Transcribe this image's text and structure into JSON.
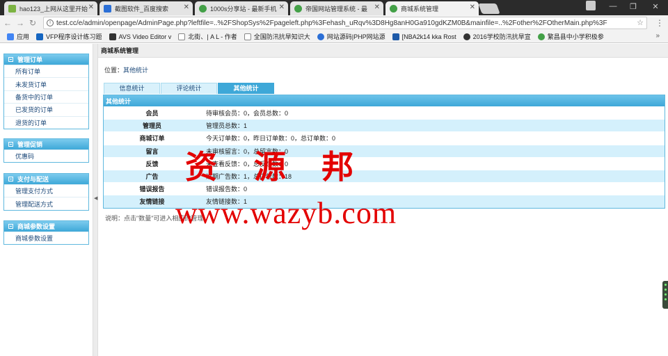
{
  "browser": {
    "tabs": [
      {
        "label": "hao123_上网从这里开始",
        "icon": "hao123-icon",
        "color": "#7cb342"
      },
      {
        "label": "截图软件_百度搜索",
        "icon": "baidu-paw-icon",
        "color": "#2b6fd6"
      },
      {
        "label": "1000s分享站 - 最新手机",
        "icon": "site-icon",
        "color": "#43a047"
      },
      {
        "label": "帝国网站管理系统 - 最",
        "icon": "site-icon",
        "color": "#43a047"
      },
      {
        "label": "商城系统管理",
        "icon": "site-icon",
        "color": "#43a047"
      }
    ],
    "url": "test.cc/e/admin/openpage/AdminPage.php?leftfile=..%2FShopSys%2Fpageleft.php%3Fehash_uRqv%3D8Hg8anH0Ga910gdKZM0B&mainfile=..%2Fother%2FOtherMain.php%3F",
    "bookmarks": [
      {
        "label": "应用",
        "color": "#4285f4"
      },
      {
        "label": "VFP程序设计练习题",
        "color": "#1565c0"
      },
      {
        "label": "AVS Video Editor v",
        "color": "#333333"
      },
      {
        "label": "北街、| A L - 作者",
        "color": "#888888"
      },
      {
        "label": "全国防汛抗旱知识大",
        "color": "#555555"
      },
      {
        "label": "网站源码|PHP网站源",
        "color": "#2b6fd6"
      },
      {
        "label": "[NBA2k14 kka Rost",
        "color": "#1e5aa8"
      },
      {
        "label": "2016学校防汛抗旱宣",
        "color": "#333333"
      },
      {
        "label": "繁昌县中小学积极参",
        "color": "#43a047"
      }
    ],
    "more": "»"
  },
  "sidebar": {
    "groups": [
      {
        "title": "管理订单",
        "items": [
          "所有订单",
          "未发货订单",
          "备货中的订单",
          "已发货的订单",
          "退货的订单"
        ]
      },
      {
        "title": "管理促销",
        "items": [
          "优惠码"
        ]
      },
      {
        "title": "支付与配送",
        "items": [
          "管理支付方式",
          "管理配送方式"
        ]
      },
      {
        "title": "商城参数设置",
        "items": [
          "商城参数设置"
        ]
      }
    ]
  },
  "main": {
    "title": "商城系统管理",
    "location_label": "位置：",
    "location_value": "其他统计",
    "tabs": [
      "信息统计",
      "评论统计",
      "其他统计"
    ],
    "active_tab": 2,
    "panel_title": "其他统计",
    "rows": [
      {
        "key": "会员",
        "value": "待审核会员：0，会员总数：0"
      },
      {
        "key": "管理员",
        "value": "管理员总数：1"
      },
      {
        "key": "商城订单",
        "value": "今天订单数：0，昨日订单数：0，总订单数：0"
      },
      {
        "key": "留言",
        "value": "未审核留言：0，总留言数：0"
      },
      {
        "key": "反馈",
        "value": "未查看反馈：0，总反馈数：0"
      },
      {
        "key": "广告",
        "value": "过期广告数：1，总广告数：18"
      },
      {
        "key": "错误报告",
        "value": "错误报告数：0"
      },
      {
        "key": "友情链接",
        "value": "友情链接数：1"
      }
    ],
    "note": "说明：点击\"数量\"可进入相应的管理"
  },
  "watermark": {
    "chars": [
      "资",
      "源",
      "邦"
    ],
    "url": "www.wazyb.com"
  },
  "colors": {
    "accent": "#3ea8d8",
    "row_alt": "#d4f0fc",
    "watermark": "#e30000"
  }
}
